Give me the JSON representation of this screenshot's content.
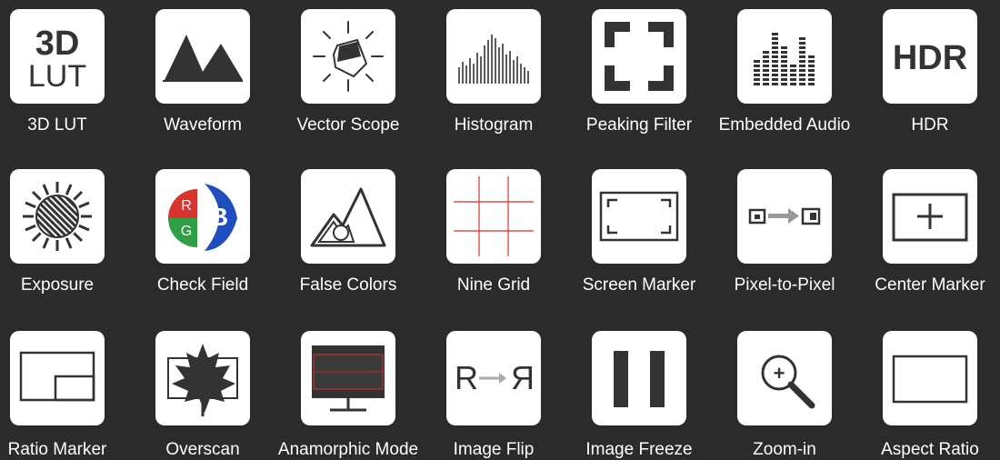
{
  "colors": {
    "background": "#2b2b2b",
    "tile": "#ffffff",
    "icon": "#333333",
    "red": "#d8332c",
    "green": "#2ea043",
    "blue": "#1f4fbf"
  },
  "features": [
    {
      "label": "3D LUT",
      "icon": "3d-lut-icon",
      "icon_text": [
        "3D",
        "LUT"
      ]
    },
    {
      "label": "Waveform",
      "icon": "waveform-icon"
    },
    {
      "label": "Vector Scope",
      "icon": "vector-scope-icon"
    },
    {
      "label": "Histogram",
      "icon": "histogram-icon"
    },
    {
      "label": "Peaking Filter",
      "icon": "peaking-filter-icon"
    },
    {
      "label": "Embedded Audio",
      "icon": "embedded-audio-icon"
    },
    {
      "label": "HDR",
      "icon": "hdr-icon",
      "icon_text": [
        "HDR"
      ]
    },
    {
      "label": "Exposure",
      "icon": "exposure-icon"
    },
    {
      "label": "Check Field",
      "icon": "check-field-icon",
      "icon_text": [
        "R",
        "G",
        "B"
      ]
    },
    {
      "label": "False Colors",
      "icon": "false-colors-icon"
    },
    {
      "label": "Nine Grid",
      "icon": "nine-grid-icon"
    },
    {
      "label": "Screen Marker",
      "icon": "screen-marker-icon"
    },
    {
      "label": "Pixel-to-Pixel",
      "icon": "pixel-to-pixel-icon"
    },
    {
      "label": "Center Marker",
      "icon": "center-marker-icon"
    },
    {
      "label": "Ratio Marker",
      "icon": "ratio-marker-icon"
    },
    {
      "label": "Overscan",
      "icon": "overscan-icon"
    },
    {
      "label": "Anamorphic Mode",
      "icon": "anamorphic-mode-icon"
    },
    {
      "label": "Image Flip",
      "icon": "image-flip-icon",
      "icon_text": [
        "R",
        "R"
      ]
    },
    {
      "label": "Image Freeze",
      "icon": "image-freeze-icon"
    },
    {
      "label": "Zoom-in",
      "icon": "zoom-in-icon",
      "icon_text": [
        "+"
      ]
    },
    {
      "label": "Aspect Ratio",
      "icon": "aspect-ratio-icon"
    }
  ]
}
